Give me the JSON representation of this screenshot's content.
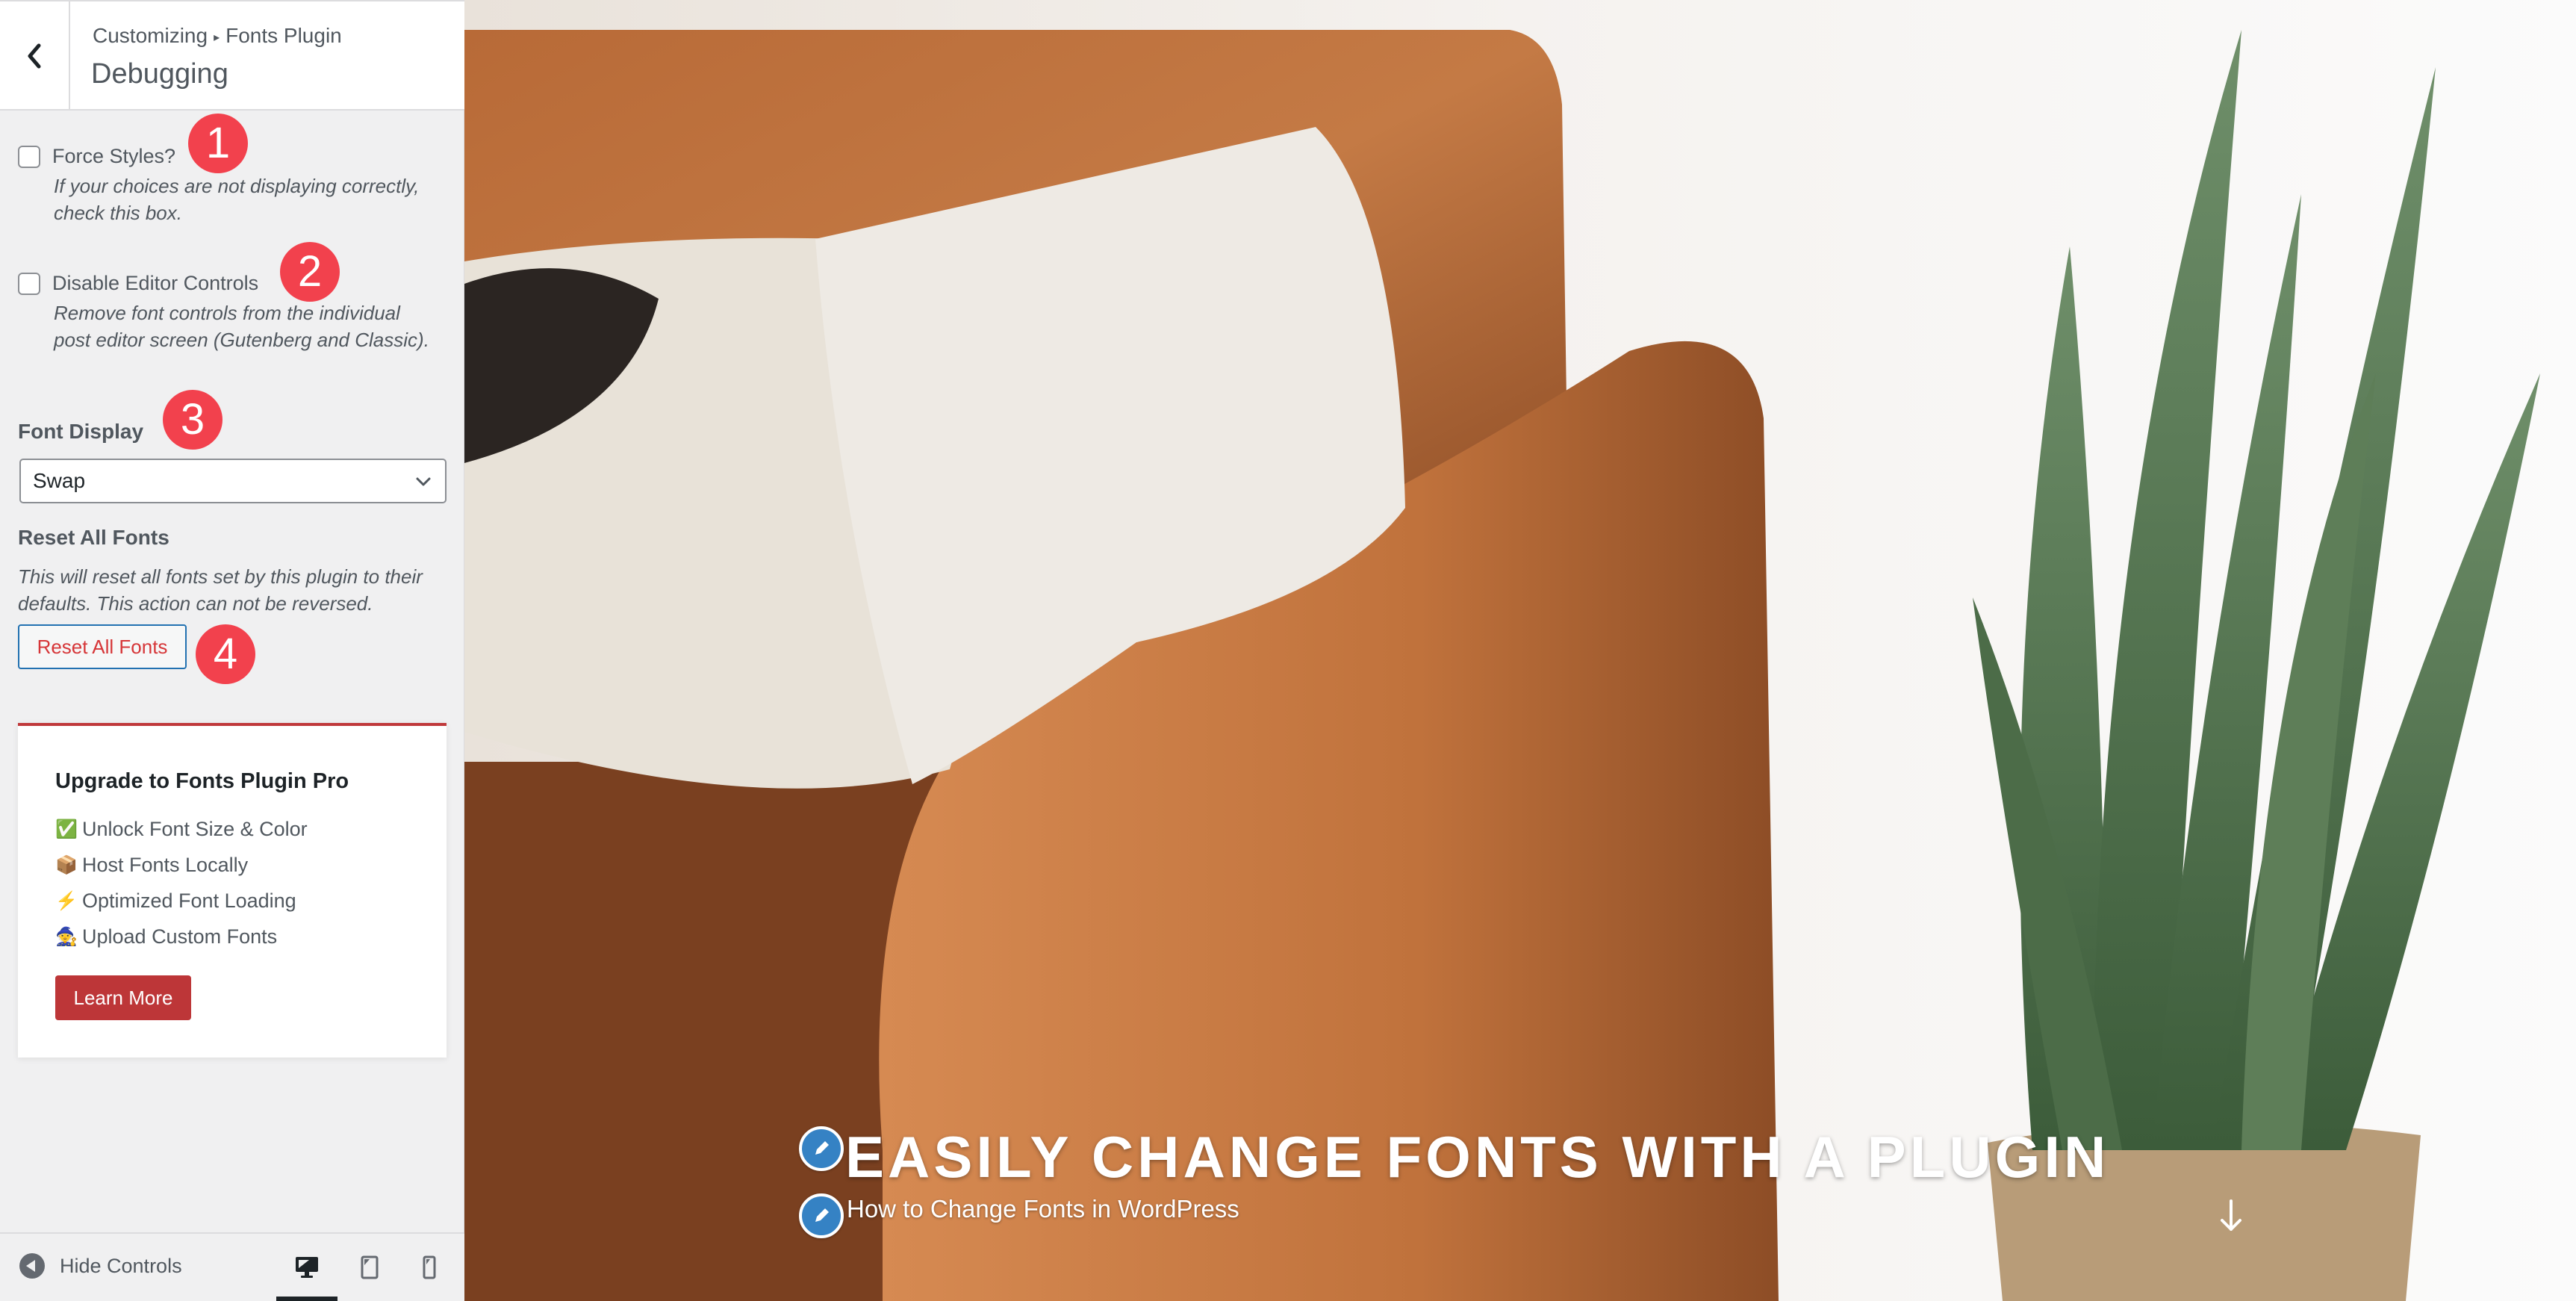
{
  "header": {
    "breadcrumb_root": "Customizing",
    "breadcrumb_separator": "▸",
    "breadcrumb_parent": "Fonts Plugin",
    "title": "Debugging"
  },
  "controls": {
    "force_styles": {
      "label": "Force Styles?",
      "checked": false,
      "description": "If your choices are not displaying correctly, check this box.",
      "badge": "1"
    },
    "disable_editor": {
      "label": "Disable Editor Controls",
      "checked": false,
      "description": "Remove font controls from the individual post editor screen (Gutenberg and Classic).",
      "badge": "2"
    },
    "font_display": {
      "label": "Font Display",
      "selected": "Swap",
      "badge": "3"
    },
    "reset": {
      "title": "Reset All Fonts",
      "description": "This will reset all fonts set by this plugin to their defaults. This action can not be reversed.",
      "button_label": "Reset All Fonts",
      "badge": "4"
    }
  },
  "upgrade": {
    "title": "Upgrade to Fonts Plugin Pro",
    "items": [
      {
        "icon": "check-mark-icon",
        "emoji": "✅",
        "label": "Unlock Font Size & Color"
      },
      {
        "icon": "package-icon",
        "emoji": "📦",
        "label": "Host Fonts Locally"
      },
      {
        "icon": "lightning-icon",
        "emoji": "⚡",
        "label": "Optimized Font Loading"
      },
      {
        "icon": "wizard-icon",
        "emoji": "🧙",
        "label": "Upload Custom Fonts"
      }
    ],
    "button_label": "Learn More"
  },
  "footer": {
    "hide_controls_label": "Hide Controls",
    "devices": [
      "desktop",
      "tablet",
      "mobile"
    ],
    "active_device": "desktop"
  },
  "preview": {
    "hero_title": "EASILY CHANGE FONTS WITH A PLUGIN",
    "hero_subtitle": "How to Change Fonts in WordPress"
  },
  "colors": {
    "badge": "#f2414d",
    "accent_red": "#bd3638",
    "link_blue": "#2271b1",
    "edit_pen_blue": "#3582c4"
  }
}
